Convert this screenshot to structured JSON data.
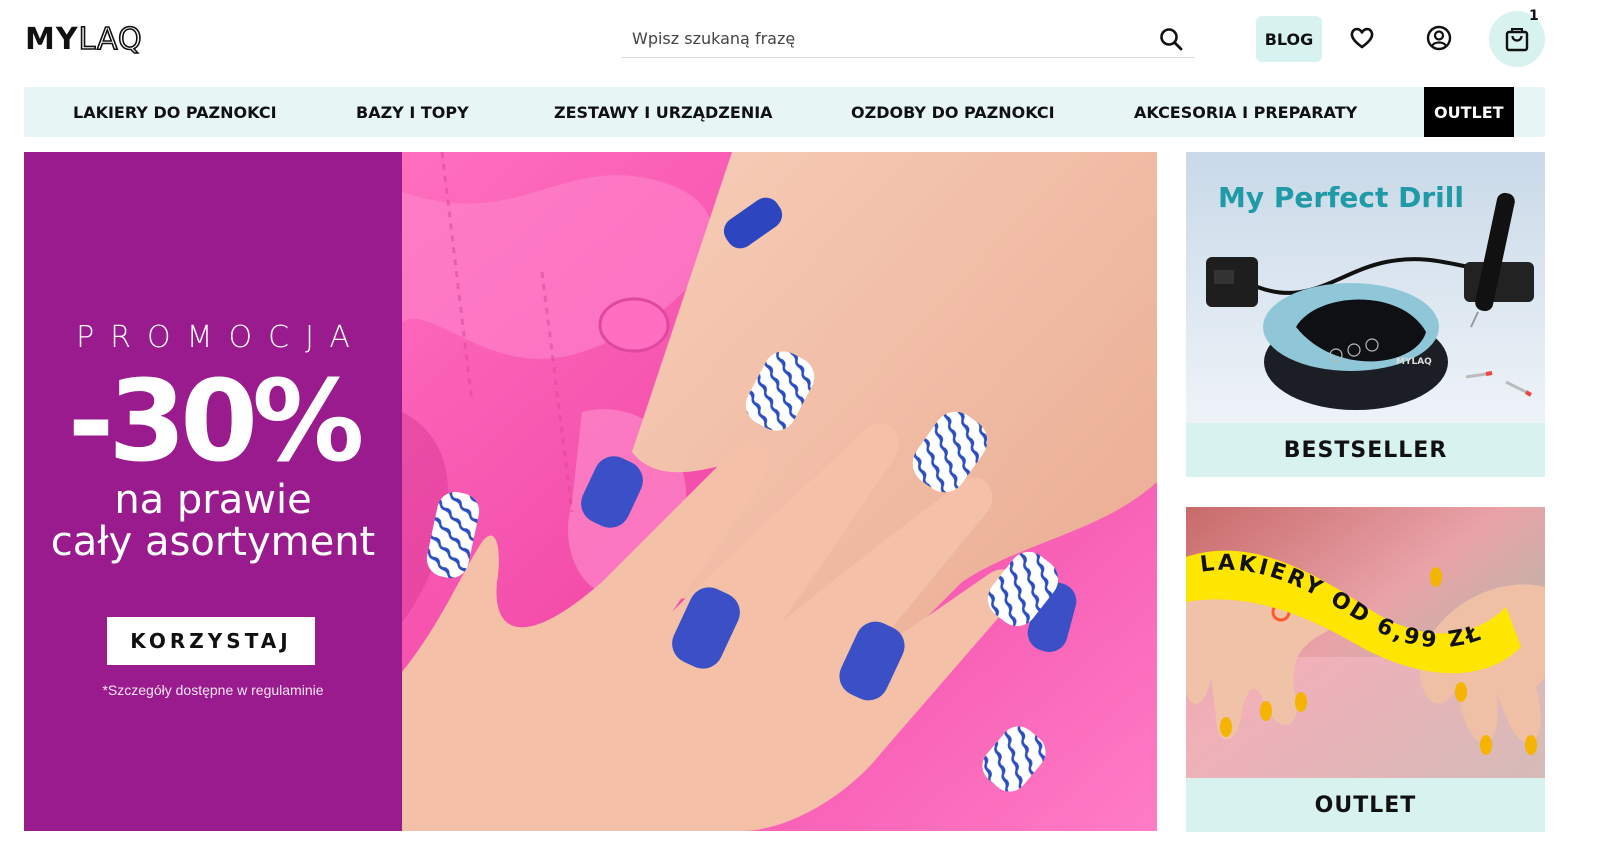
{
  "header": {
    "logo": {
      "part1": "MY",
      "part2": "LAQ"
    },
    "search": {
      "placeholder": "Wpisz szukaną frazę",
      "value": "",
      "icon": "search-icon"
    },
    "blog_label": "BLOG",
    "wishlist_icon": "heart-icon",
    "account_icon": "user-circle-icon",
    "cart": {
      "icon": "shopping-bag-icon",
      "count": "1"
    }
  },
  "nav": {
    "items": [
      {
        "label": "LAKIERY DO PAZNOKCI"
      },
      {
        "label": "BAZY I TOPY"
      },
      {
        "label": "ZESTAWY I URZĄDZENIA"
      },
      {
        "label": "OZDOBY DO PAZNOKCI"
      },
      {
        "label": "AKCESORIA I PREPARATY"
      },
      {
        "label": "OUTLET"
      }
    ]
  },
  "hero": {
    "kicker": "PROMOCJA",
    "big": "-30%",
    "line1": "na prawie",
    "line2": "cały asortyment",
    "cta": "KORZYSTAJ",
    "terms": "*Szczegóły dostępne w regulaminie",
    "panel_color": "#9a1b8e"
  },
  "side": {
    "drill": {
      "title": "My Perfect Drill",
      "device_brand": "MYLAQ",
      "label": "BESTSELLER"
    },
    "outlet": {
      "ribbon": "LAKIERY OD 6,99 ZŁ",
      "label": "OUTLET"
    }
  },
  "colors": {
    "accent_mint": "#d8f2ef",
    "nav_bg": "#e7f6f5",
    "promo_purple": "#9a1b8e",
    "drill_title": "#1f9aa6"
  }
}
